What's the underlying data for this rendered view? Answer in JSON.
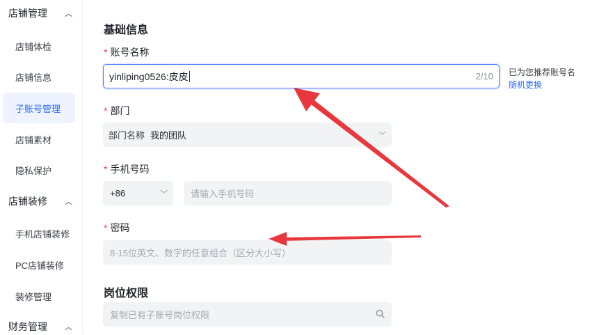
{
  "sidebar": {
    "groups": [
      {
        "title": "店铺管理",
        "items": [
          "店铺体检",
          "店铺信息",
          "子账号管理",
          "店铺素材",
          "隐私保护"
        ]
      },
      {
        "title": "店铺装修",
        "items": [
          "手机店铺装修",
          "PC店铺装修",
          "装修管理"
        ]
      },
      {
        "title": "财务管理",
        "items": []
      }
    ],
    "active_item": "子账号管理"
  },
  "basic_info": {
    "title": "基础信息",
    "account_name": {
      "label": "账号名称",
      "value": "yinliping0526:皮皮",
      "count": "2/10",
      "suggest_text": "已为您推荐账号名",
      "suggest_link": "随机更换"
    },
    "department": {
      "label": "部门",
      "prefix": "部门名称",
      "value": "我的团队"
    },
    "phone": {
      "label": "手机号码",
      "country_code": "+86",
      "placeholder": "请输入手机号码"
    },
    "password": {
      "label": "密码",
      "placeholder": "8-15位英文、数字的任意组合（区分大小写）"
    }
  },
  "permissions": {
    "title": "岗位权限",
    "search_placeholder": "复制已有子账号岗位权限"
  },
  "colors": {
    "accent": "#2b6bff",
    "required_star": "#f5464a",
    "annotation_arrow": "#e8383d"
  }
}
